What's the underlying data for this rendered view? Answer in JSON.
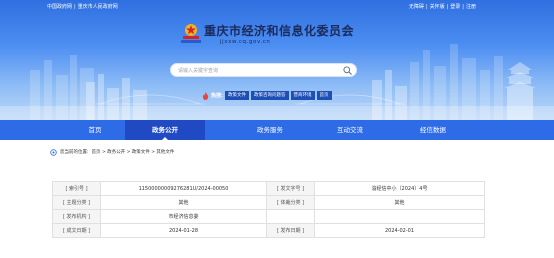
{
  "topbar": {
    "left_links": [
      "中国政府网",
      "重庆市人民政府网"
    ],
    "right_links": [
      "无障碍",
      "关怀版",
      "登录",
      "注册"
    ]
  },
  "header": {
    "site_title": "重庆市经济和信息化委员会",
    "site_domain": "jjxxw.cq.gov.cn"
  },
  "search": {
    "placeholder": "请输入关键字查询",
    "icon": "search-icon"
  },
  "hot": {
    "label": "热搜:",
    "icon": "fire-icon",
    "tags": [
      "政策文件",
      "政策咨询问题答",
      "营商环境",
      "首页"
    ]
  },
  "nav": {
    "items": [
      {
        "label": "首页",
        "active": false
      },
      {
        "label": "政务公开",
        "active": true
      },
      {
        "label": "政务服务",
        "active": false
      },
      {
        "label": "互动交流",
        "active": false
      },
      {
        "label": "经信数据",
        "active": false
      }
    ]
  },
  "breadcrumb": {
    "prefix": "您当前的位置:",
    "path": "首页 > 政务公开 > 政策文件 > 其他文件"
  },
  "info": {
    "rows": [
      {
        "l1": "[ 索引号 ]",
        "v1": "11500000009276281U/2024-00050",
        "l2": "[ 发文字号 ]",
        "v2": "渝经信中小〔2024〕4号"
      },
      {
        "l1": "[ 主题分类 ]",
        "v1": "其他",
        "l2": "[ 体裁分类 ]",
        "v2": "其他"
      },
      {
        "l1": "[ 发布机构 ]",
        "v1": "市经济信息委",
        "l2": "",
        "v2": ""
      },
      {
        "l1": "[ 成文日期 ]",
        "v1": "2024-01-28",
        "l2": "[ 发布日期 ]",
        "v2": "2024-02-01"
      }
    ]
  },
  "colors": {
    "hero_top": "#2f6fe0",
    "nav_bg": "#2e6be6",
    "nav_active": "#1f4ac4",
    "title": "#1a2b5c",
    "tag_bg": "#1e4fb5",
    "fire": "#e8453c"
  }
}
